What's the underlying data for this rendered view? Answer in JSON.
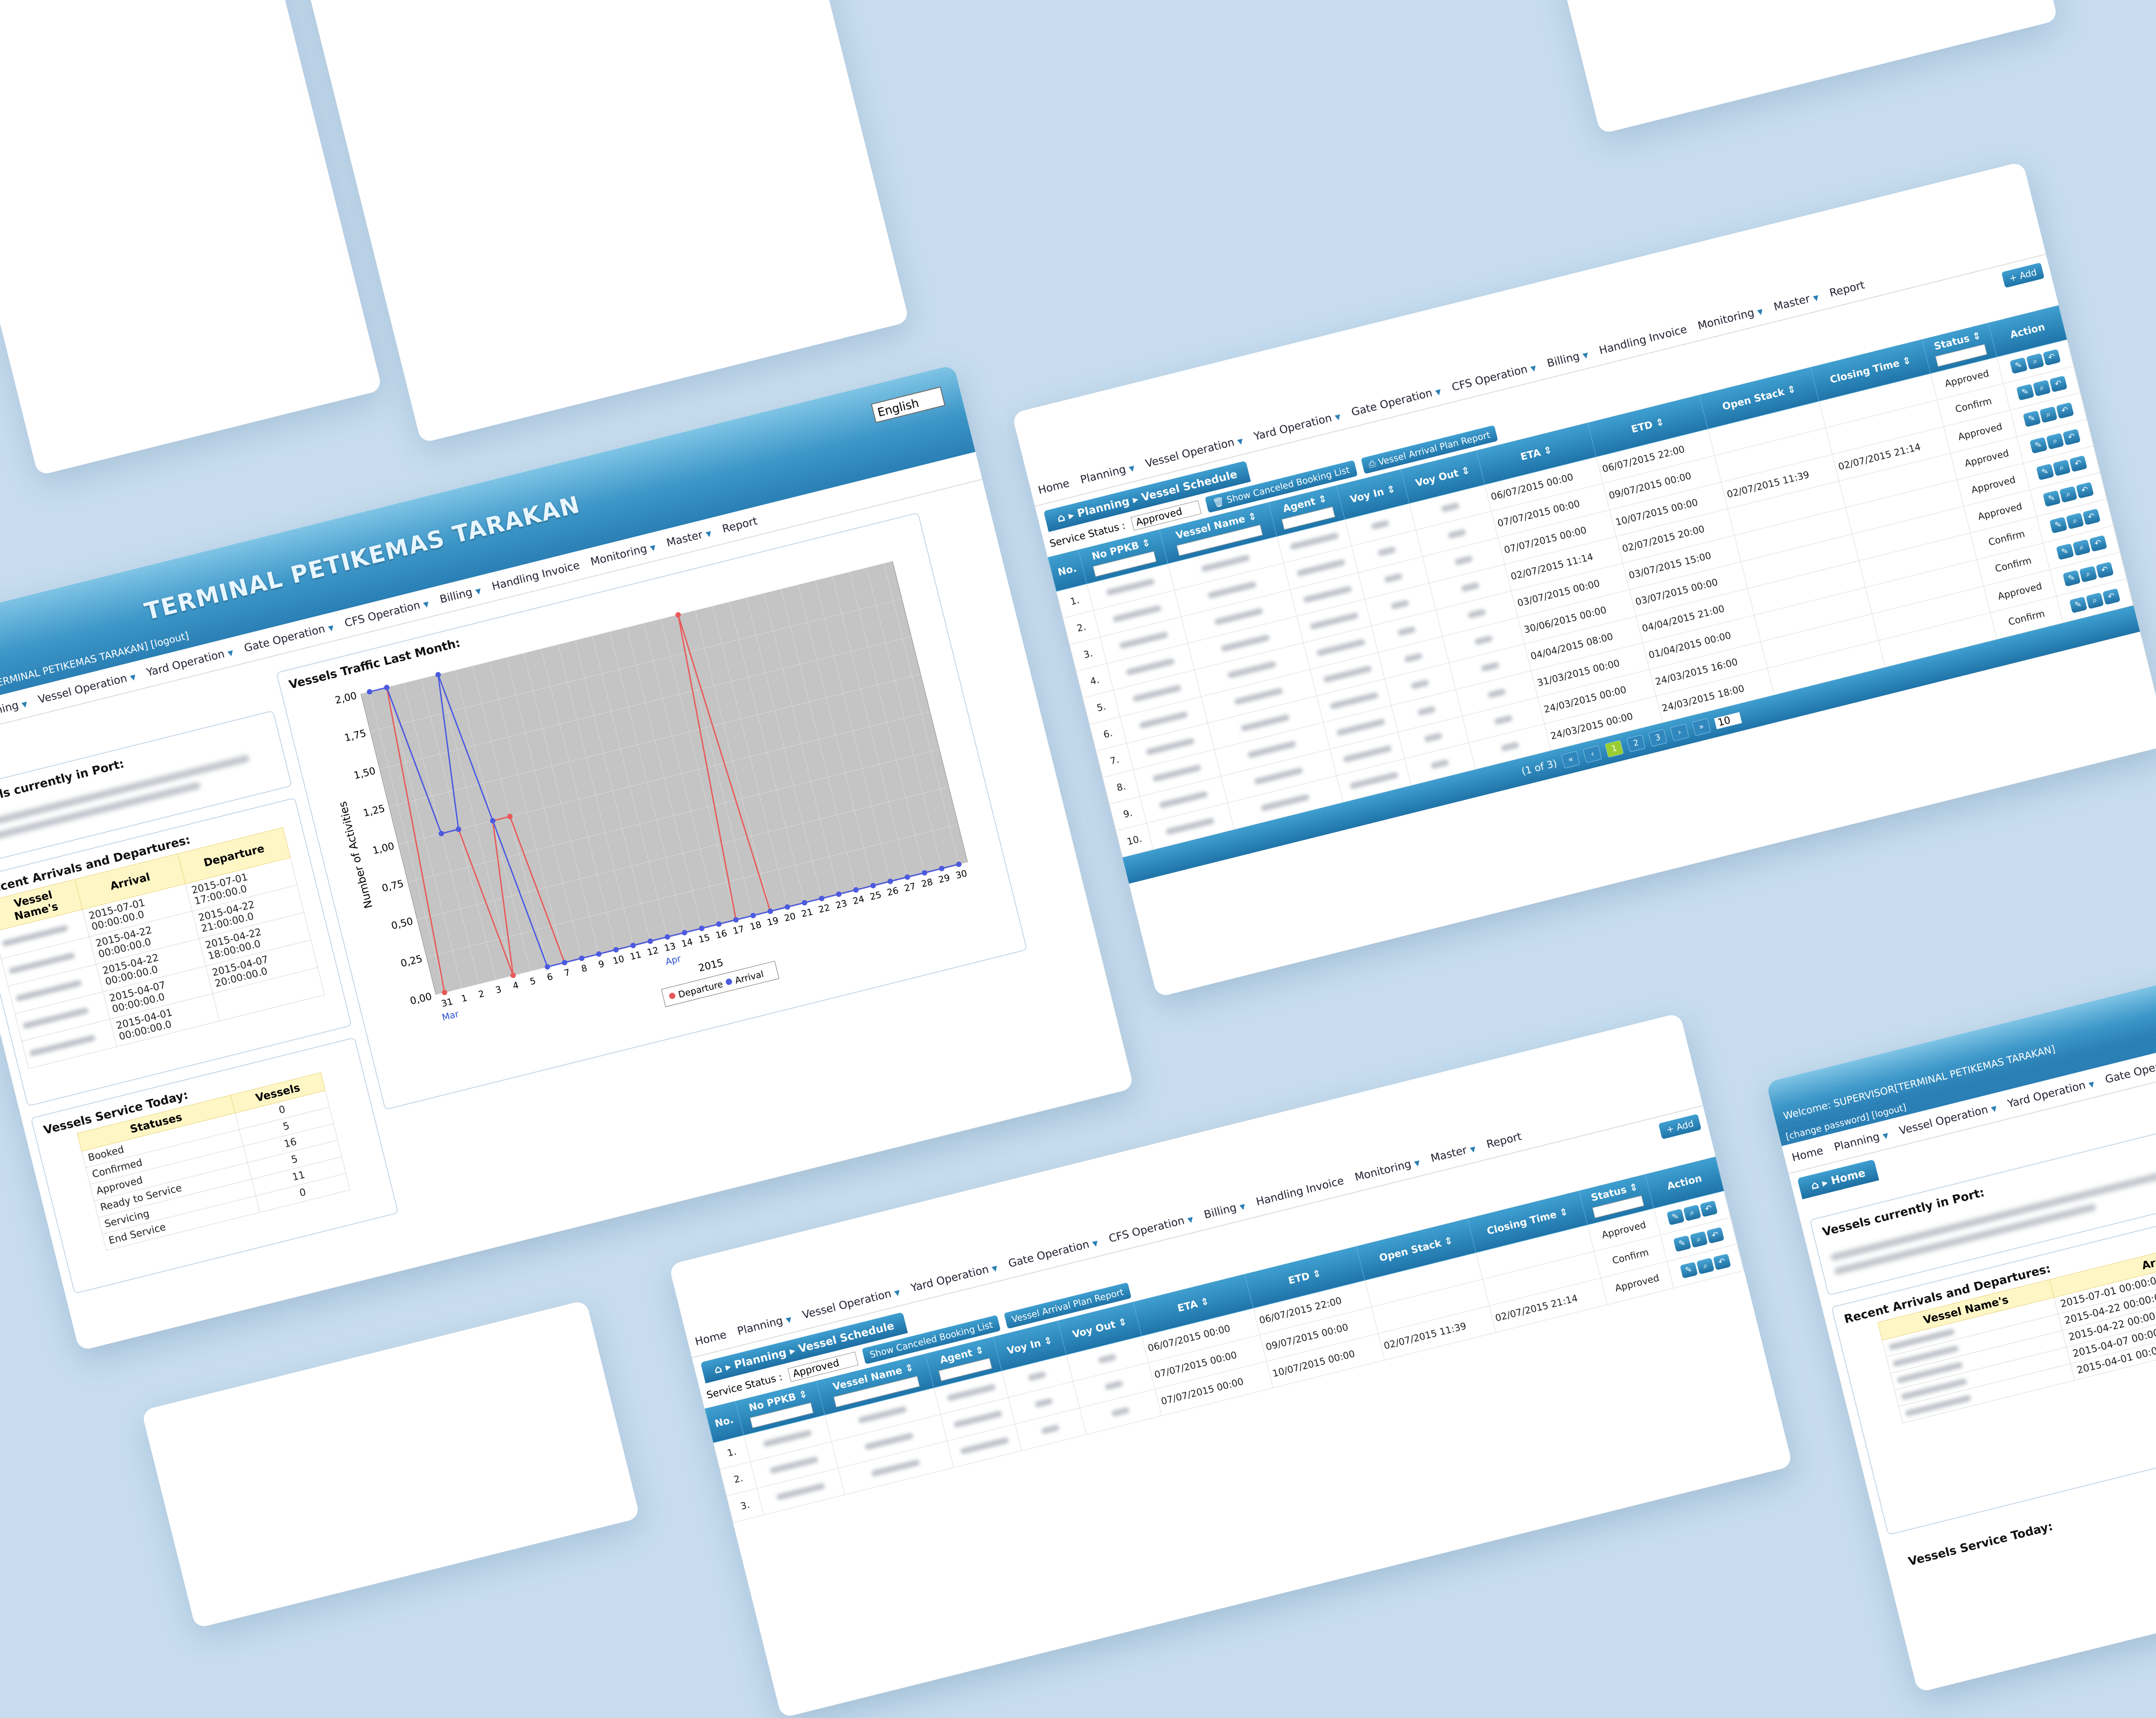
{
  "app": {
    "logo": "TERMINAL PETIKEMAS TARAKAN",
    "language": "English",
    "welcome_label": "Welcome:",
    "welcome_user": "SUPERVISOR[TERMINAL PETIKEMAS TARAKAN]",
    "change_password": "[change password]",
    "logout": "[logout]"
  },
  "menu": [
    {
      "label": "Home",
      "dd": false
    },
    {
      "label": "Planning",
      "dd": true
    },
    {
      "label": "Vessel Operation",
      "dd": true
    },
    {
      "label": "Yard Operation",
      "dd": true
    },
    {
      "label": "Gate Operation",
      "dd": true
    },
    {
      "label": "CFS Operation",
      "dd": true
    },
    {
      "label": "Billing",
      "dd": true
    },
    {
      "label": "Handling Invoice",
      "dd": false
    },
    {
      "label": "Monitoring",
      "dd": true
    },
    {
      "label": "Master",
      "dd": true
    },
    {
      "label": "Report",
      "dd": false
    }
  ],
  "dashboard": {
    "home_crumb": "Home",
    "vessels_in_port_title": "Vessels currently in Port:",
    "recent_title": "Recent Arrivals and Departures:",
    "recent_headers": [
      "Vessel Name's",
      "Arrival",
      "Departure"
    ],
    "recent_rows": [
      {
        "arrival": "2015-07-01 00:00:00.0",
        "departure": "2015-07-01 17:00:00.0"
      },
      {
        "arrival": "2015-04-22 00:00:00.0",
        "departure": "2015-04-22 21:00:00.0"
      },
      {
        "arrival": "2015-04-22 00:00:00.0",
        "departure": "2015-04-22 18:00:00.0"
      },
      {
        "arrival": "2015-04-07 00:00:00.0",
        "departure": "2015-04-07 20:00:00.0"
      },
      {
        "arrival": "2015-04-01 00:00:00.0",
        "departure": ""
      }
    ],
    "service_title": "Vessels Service Today:",
    "service_headers": [
      "Statuses",
      "Vessels"
    ],
    "service_rows": [
      {
        "status": "Booked",
        "count": "0"
      },
      {
        "status": "Confirmed",
        "count": "5"
      },
      {
        "status": "Approved",
        "count": "16"
      },
      {
        "status": "Ready to Service",
        "count": "5"
      },
      {
        "status": "Servicing",
        "count": "11"
      },
      {
        "status": "End Service",
        "count": "0"
      }
    ],
    "traffic_title": "Vessels Traffic Last Month:"
  },
  "chart_data": {
    "type": "line",
    "title": "",
    "ylabel": "Number of Activities",
    "xlabel": "2015",
    "ylim": [
      0,
      2.0
    ],
    "yticks": [
      "0,00",
      "0,25",
      "0,50",
      "0,75",
      "1,00",
      "1,25",
      "1,50",
      "1,75",
      "2,00"
    ],
    "categories": [
      "31",
      "1",
      "2",
      "3",
      "4",
      "5",
      "6",
      "7",
      "8",
      "9",
      "10",
      "11",
      "12",
      "13",
      "14",
      "15",
      "16",
      "17",
      "18",
      "19",
      "20",
      "21",
      "22",
      "23",
      "24",
      "25",
      "26",
      "27",
      "28",
      "29",
      "30"
    ],
    "month_labels": [
      {
        "at": "31",
        "label": "Mar"
      },
      {
        "at": "13",
        "label": "Apr"
      }
    ],
    "series": [
      {
        "name": "Departure",
        "color": "#e85a5a",
        "values": [
          0,
          2,
          1,
          1,
          0,
          1,
          1,
          0,
          0,
          0,
          0,
          0,
          0,
          0,
          0,
          0,
          0,
          0,
          2,
          0,
          0,
          0,
          0,
          0,
          0,
          0,
          0,
          0,
          0,
          0,
          0
        ]
      },
      {
        "name": "Arrival",
        "color": "#4a5be0",
        "values": [
          2,
          2,
          1,
          1,
          2,
          1,
          0,
          0,
          0,
          0,
          0,
          0,
          0,
          0,
          0,
          0,
          0,
          0,
          0,
          0,
          0,
          0,
          0,
          0,
          0,
          0,
          0,
          0,
          0,
          0,
          0
        ]
      }
    ],
    "grid": true,
    "legend": "bottom"
  },
  "schedule": {
    "crumb_root": "Planning",
    "crumb_page": "Vessel Schedule",
    "add_label": "Add",
    "service_status_label": "Service Status :",
    "service_status_value": "Approved",
    "show_canceled": "Show Canceled Booking List",
    "arrival_report": "Vessel Arrival Plan Report",
    "headers": [
      "No.",
      "No PPKB",
      "Vessel Name",
      "Agent",
      "Voy In",
      "Voy Out",
      "ETA",
      "ETD",
      "Open Stack",
      "Closing Time",
      "Status",
      "Action"
    ],
    "rows": [
      {
        "no": "1.",
        "eta": "06/07/2015 00:00",
        "etd": "06/07/2015 22:00",
        "open": "",
        "close": "",
        "status": "Approved"
      },
      {
        "no": "2.",
        "eta": "07/07/2015 00:00",
        "etd": "09/07/2015 00:00",
        "open": "",
        "close": "",
        "status": "Confirm"
      },
      {
        "no": "3.",
        "eta": "07/07/2015 00:00",
        "etd": "10/07/2015 00:00",
        "open": "02/07/2015 11:39",
        "close": "02/07/2015 21:14",
        "status": "Approved"
      },
      {
        "no": "4.",
        "eta": "02/07/2015 11:14",
        "etd": "02/07/2015 20:00",
        "open": "",
        "close": "",
        "status": "Approved"
      },
      {
        "no": "5.",
        "eta": "03/07/2015 00:00",
        "etd": "03/07/2015 15:00",
        "open": "",
        "close": "",
        "status": "Approved"
      },
      {
        "no": "6.",
        "eta": "30/06/2015 00:00",
        "etd": "03/07/2015 00:00",
        "open": "",
        "close": "",
        "status": "Approved"
      },
      {
        "no": "7.",
        "eta": "04/04/2015 08:00",
        "etd": "04/04/2015 21:00",
        "open": "",
        "close": "",
        "status": "Confirm"
      },
      {
        "no": "8.",
        "eta": "31/03/2015 00:00",
        "etd": "01/04/2015 00:00",
        "open": "",
        "close": "",
        "status": "Confirm"
      },
      {
        "no": "9.",
        "eta": "24/03/2015 00:00",
        "etd": "24/03/2015 16:00",
        "open": "",
        "close": "",
        "status": "Approved"
      },
      {
        "no": "10.",
        "eta": "24/03/2015 00:00",
        "etd": "24/03/2015 18:00",
        "open": "",
        "close": "",
        "status": "Confirm"
      }
    ],
    "pager_text": "(1 of 3)",
    "pages": [
      "1",
      "2",
      "3"
    ],
    "page_size": "10"
  },
  "colors": {
    "accent": "#2a7fb4",
    "header_yellow": "#fff6c6",
    "page_bg": "#c7ddef"
  },
  "icons": [
    "edit-icon",
    "search-icon",
    "undo-icon",
    "home-icon",
    "plus-icon",
    "trash-icon",
    "print-icon"
  ]
}
